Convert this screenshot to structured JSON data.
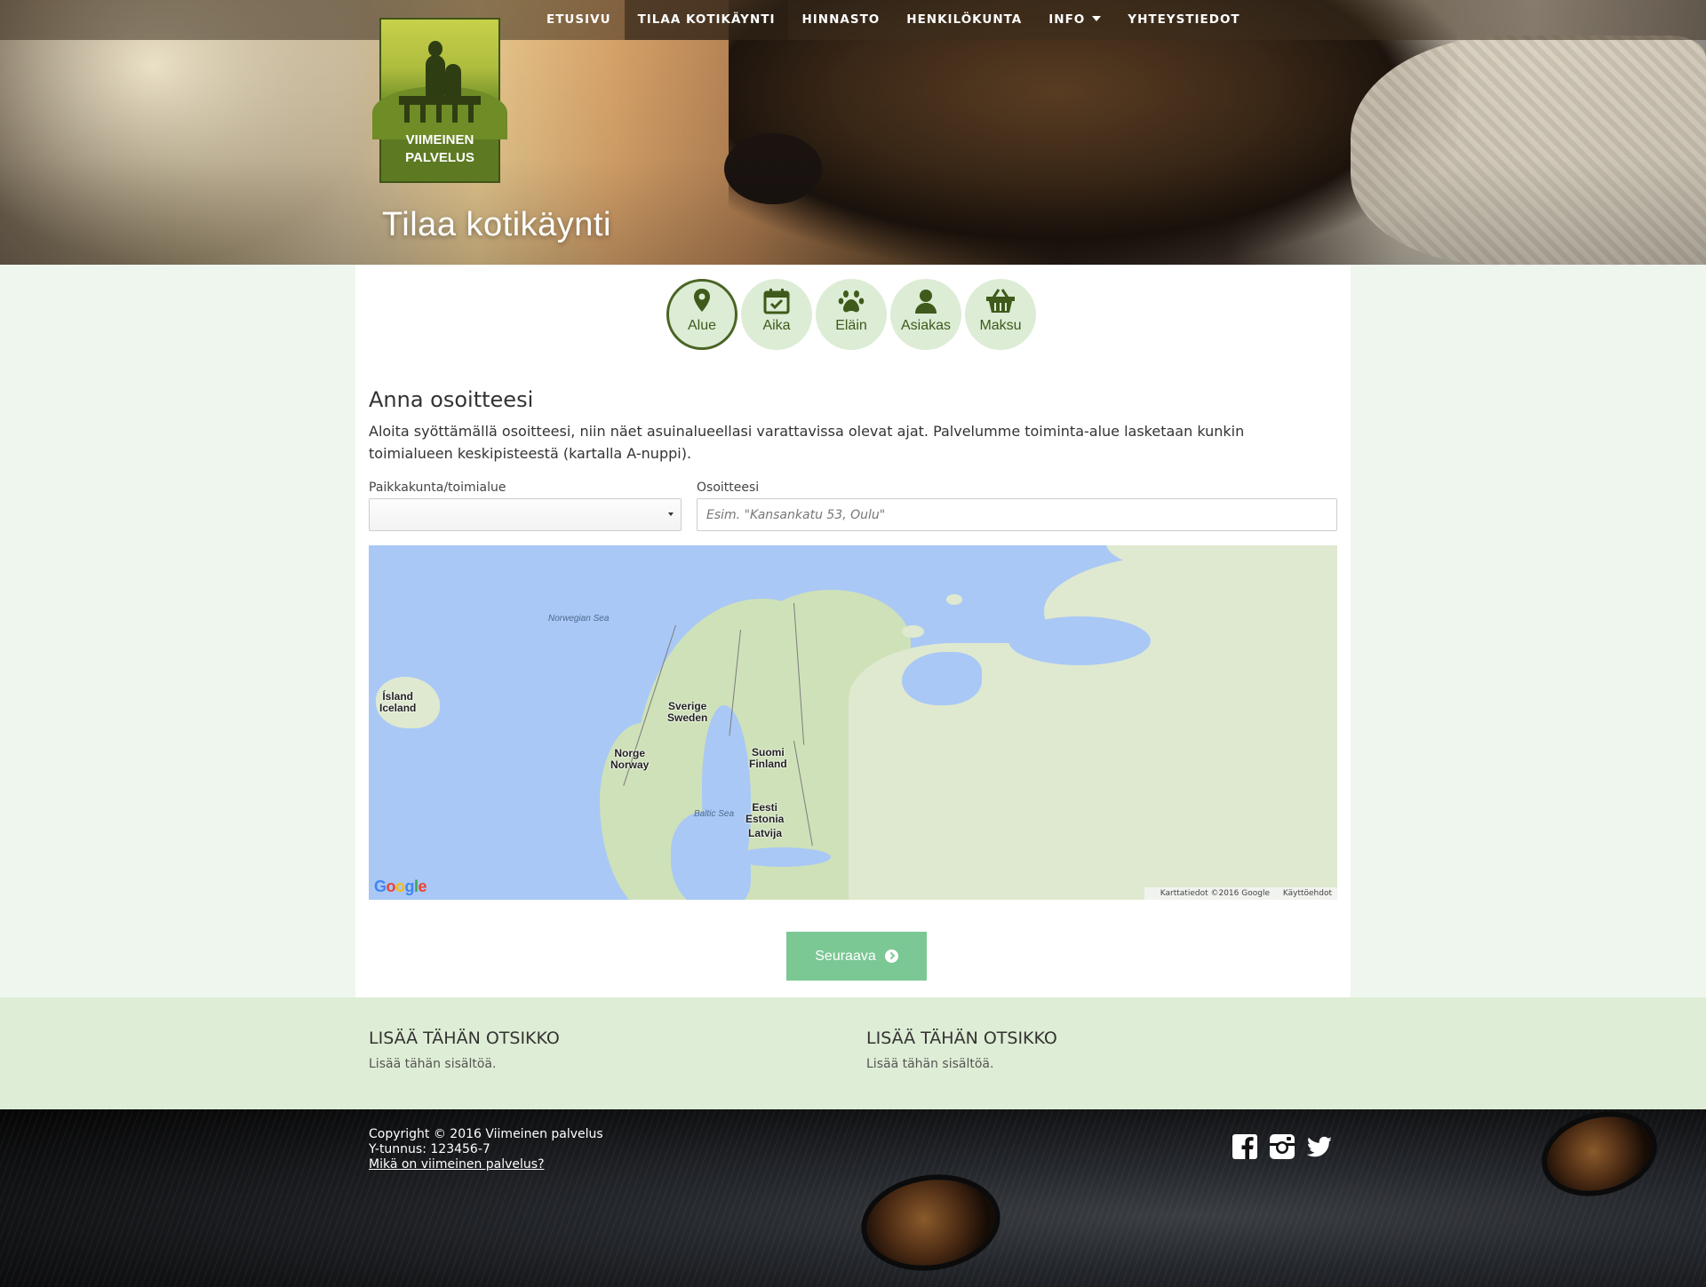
{
  "nav": {
    "items": [
      {
        "label": "ETUSIVU"
      },
      {
        "label": "TILAA KOTIKÄYNTI"
      },
      {
        "label": "HINNASTO"
      },
      {
        "label": "HENKILÖKUNTA"
      },
      {
        "label": "INFO"
      },
      {
        "label": "YHTEYSTIEDOT"
      }
    ],
    "active_index": 1
  },
  "logo": {
    "line1": "VIIMEINEN",
    "line2": "PALVELUS"
  },
  "hero": {
    "title": "Tilaa kotikäynti"
  },
  "steps": [
    {
      "label": "Alue",
      "icon": "map-marker-icon",
      "active": true
    },
    {
      "label": "Aika",
      "icon": "calendar-check-icon",
      "active": false
    },
    {
      "label": "Eläin",
      "icon": "paw-icon",
      "active": false
    },
    {
      "label": "Asiakas",
      "icon": "user-icon",
      "active": false
    },
    {
      "label": "Maksu",
      "icon": "basket-icon",
      "active": false
    }
  ],
  "form": {
    "title": "Anna osoitteesi",
    "intro": "Aloita syöttämällä osoitteesi, niin näet asuinalueellasi varattavissa olevat ajat. Palvelumme toiminta-alue lasketaan kunkin toimialueen keskipisteestä (kartalla A-nuppi).",
    "region_label": "Paikkakunta/toimialue",
    "region_value": "",
    "address_label": "Osoitteesi",
    "address_placeholder": "Esim. \"Kansankatu 53, Oulu\"",
    "address_value": ""
  },
  "map": {
    "sea_labels": {
      "norwegian": "Norwegian Sea",
      "baltic": "Baltic Sea"
    },
    "places": {
      "iceland": [
        "Ísland",
        "Iceland"
      ],
      "sweden": [
        "Sverige",
        "Sweden"
      ],
      "norway": [
        "Norge",
        "Norway"
      ],
      "finland": [
        "Suomi",
        "Finland"
      ],
      "estonia": [
        "Eesti",
        "Estonia"
      ],
      "latvia": [
        "Latvija"
      ]
    },
    "brand": "Google",
    "attribution": "Karttatiedot ©2016 Google",
    "terms": "Käyttöehdot"
  },
  "next_button": {
    "label": "Seuraava"
  },
  "band": {
    "col1": {
      "title": "LISÄÄ TÄHÄN OTSIKKO",
      "text": "Lisää tähän sisältöä."
    },
    "col2": {
      "title": "LISÄÄ TÄHÄN OTSIKKO",
      "text": "Lisää tähän sisältöä."
    }
  },
  "footer": {
    "copyright": "Copyright © 2016 Viimeinen palvelus",
    "business_id": "Y-tunnus: 123456-7",
    "link": "Mikä on viimeinen palvelus?",
    "social": [
      "facebook-icon",
      "instagram-icon",
      "twitter-icon"
    ]
  },
  "colors": {
    "brand_green": "#4a6424",
    "step_bg": "#dcecd5",
    "button": "#7bc894",
    "band": "#deedd5",
    "map_water": "#a9c8f5",
    "map_land": "#dfe9cf"
  }
}
